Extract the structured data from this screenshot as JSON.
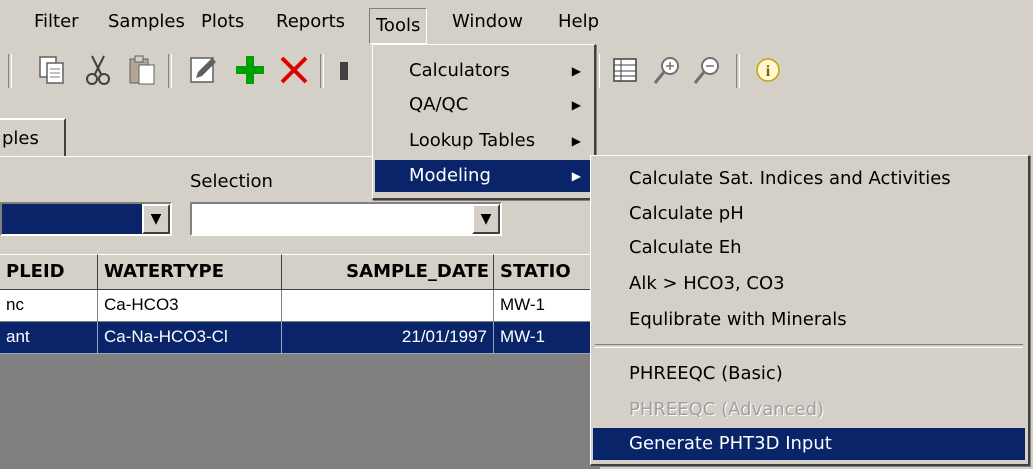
{
  "menubar": {
    "items": [
      "Filter",
      "Samples",
      "Plots",
      "Reports",
      "Tools",
      "Window",
      "Help"
    ]
  },
  "toolbar": {
    "icons": [
      "copy-icon",
      "cut-icon",
      "paste-icon",
      "edit-icon",
      "add-icon",
      "delete-icon",
      "binoculars-icon",
      "grid-icon",
      "zoom-in-icon",
      "zoom-out-icon",
      "info-icon"
    ],
    "colors": {
      "add": "#00a000",
      "delete": "#e00000",
      "info": "#c8a000"
    }
  },
  "tab": {
    "label": "ples"
  },
  "filter": {
    "selection_label": "Selection"
  },
  "grid": {
    "headers": [
      "PLEID",
      "WATERTYPE",
      "SAMPLE_DATE",
      "STATIO"
    ],
    "rows": [
      {
        "id": "nc",
        "watertype": "Ca-HCO3",
        "date": "",
        "station": "MW-1",
        "selected": false
      },
      {
        "id": "ant",
        "watertype": "Ca-Na-HCO3-Cl",
        "date": "21/01/1997",
        "station": "MW-1",
        "selected": true
      }
    ]
  },
  "tools_menu": {
    "items": [
      {
        "label": "Calculators",
        "submenu": true
      },
      {
        "label": "QA/QC",
        "submenu": true
      },
      {
        "label": "Lookup Tables",
        "submenu": true
      },
      {
        "label": "Modeling",
        "submenu": true,
        "highlighted": true
      }
    ]
  },
  "modeling_menu": {
    "items": [
      {
        "label": "Calculate Sat. Indices and Activities"
      },
      {
        "label": "Calculate pH"
      },
      {
        "label": "Calculate Eh"
      },
      {
        "label": "Alk > HCO3, CO3"
      },
      {
        "label": "Equlibrate with Minerals"
      },
      {
        "label": "PHREEQC (Basic)"
      },
      {
        "label": "PHREEQC (Advanced)",
        "disabled": true
      },
      {
        "label": "Generate PHT3D Input",
        "highlighted": true
      }
    ]
  },
  "colors": {
    "menu_bg": "#d4d0c8",
    "highlight": "#0a246a",
    "grid_bg": "#808080"
  }
}
